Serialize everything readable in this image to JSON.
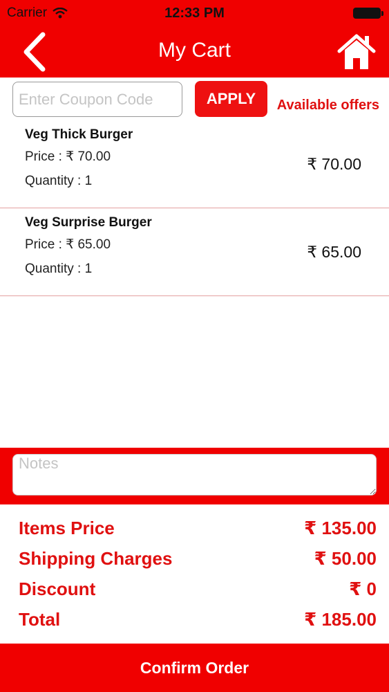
{
  "status_bar": {
    "carrier": "Carrier",
    "time": "12:33 PM",
    "icons": [
      "wifi-icon",
      "battery-icon"
    ]
  },
  "nav": {
    "title": "My Cart",
    "icons": [
      "back-arrow-icon",
      "home-icon"
    ]
  },
  "coupon": {
    "placeholder": "Enter Coupon Code",
    "apply_label": "APPLY",
    "offers_label": "Available offers"
  },
  "cart_items": [
    {
      "name": "Veg Thick Burger",
      "price": "Price : ₹ 70.00",
      "quantity": "Quantity : 1",
      "total": "₹ 70.00"
    },
    {
      "name": "Veg Surprise Burger",
      "price": "Price : ₹ 65.00",
      "quantity": "Quantity : 1",
      "total": "₹ 65.00"
    }
  ],
  "notes": {
    "placeholder": "Notes"
  },
  "summary": [
    {
      "label": "Items Price",
      "value": "₹ 135.00"
    },
    {
      "label": "Shipping Charges",
      "value": "₹ 50.00"
    },
    {
      "label": "Discount",
      "value": "₹ 0"
    },
    {
      "label": "Total",
      "value": "₹ 185.00"
    }
  ],
  "confirm_label": "Confirm Order",
  "colors": {
    "brand_red": "#f00000",
    "text_red": "#e01010",
    "divider": "#e3a0a0"
  }
}
